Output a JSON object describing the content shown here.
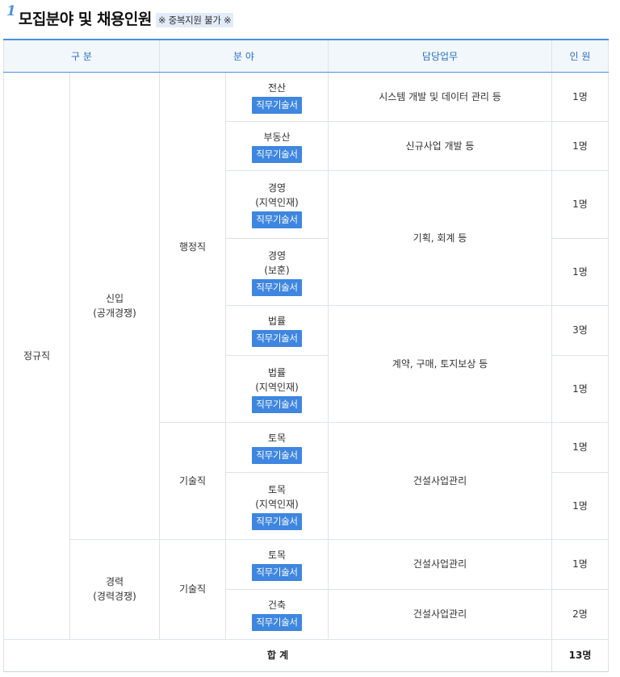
{
  "heading": {
    "number": "1",
    "title": "모집분야 및 채용인원",
    "note": "※ 중복지원 불가 ※"
  },
  "table": {
    "headers": {
      "category": "구 분",
      "field": "분 야",
      "duty": "담당업무",
      "count": "인 원"
    },
    "button_label": "직무기술서",
    "type_regular": "정규직",
    "group_new_name": "신입",
    "group_new_sub": "(공개경쟁)",
    "group_exp_name": "경력",
    "group_exp_sub": "(경력경쟁)",
    "job_admin": "행정직",
    "job_tech": "기술직",
    "rows": [
      {
        "field": "전산",
        "sub": "",
        "duty": "시스템 개발 및 데이터 관리 등",
        "count": "1명"
      },
      {
        "field": "부동산",
        "sub": "",
        "duty": "신규사업 개발 등",
        "count": "1명"
      },
      {
        "field": "경영",
        "sub": "(지역인재)",
        "duty": "기획, 회계 등",
        "count": "1명"
      },
      {
        "field": "경영",
        "sub": "(보훈)",
        "duty": "",
        "count": "1명"
      },
      {
        "field": "법률",
        "sub": "",
        "duty": "계약, 구매, 토지보상 등",
        "count": "3명"
      },
      {
        "field": "법률",
        "sub": "(지역인재)",
        "duty": "",
        "count": "1명"
      },
      {
        "field": "토목",
        "sub": "",
        "duty": "건설사업관리",
        "count": "1명"
      },
      {
        "field": "토목",
        "sub": "(지역인재)",
        "duty": "",
        "count": "1명"
      },
      {
        "field": "토목",
        "sub": "",
        "duty": "건설사업관리",
        "count": "1명"
      },
      {
        "field": "건축",
        "sub": "",
        "duty": "건설사업관리",
        "count": "2명"
      }
    ],
    "total_label": "합 계",
    "total_count": "13명"
  }
}
